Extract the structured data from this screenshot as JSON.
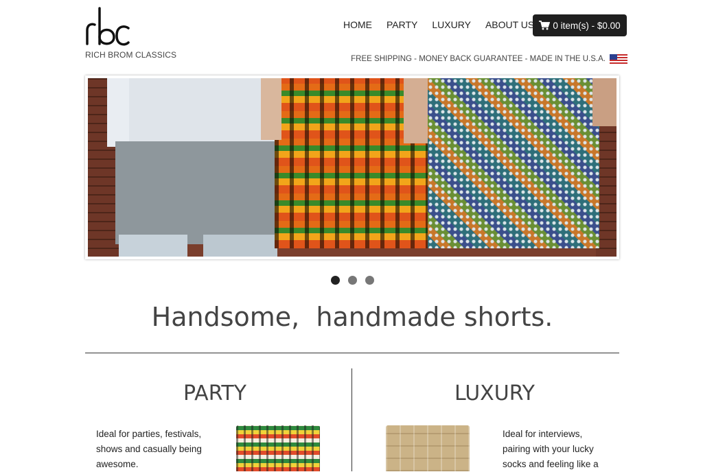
{
  "brand": {
    "logo_text": "rbc",
    "name": "RICH BROM CLASSICS"
  },
  "nav": [
    {
      "label": "HOME"
    },
    {
      "label": "PARTY"
    },
    {
      "label": "LUXURY"
    },
    {
      "label": "ABOUT US"
    }
  ],
  "cart": {
    "label": "0 item(s) - $0.00",
    "icon": "shopping-cart-icon"
  },
  "shipping_banner": {
    "text": "FREE SHIPPING - MONEY BACK GUARANTEE - MADE IN THE U.S.A.",
    "icon": "us-flag-icon"
  },
  "carousel": {
    "slides": 3,
    "active_slide": 1
  },
  "tagline": "Handsome,  handmade shorts.",
  "sections": {
    "party": {
      "title": "PARTY",
      "text": "Ideal for parties, festivals, shows and casually being awesome."
    },
    "luxury": {
      "title": "LUXURY",
      "text": "Ideal for interviews, pairing with your lucky socks and feeling like a"
    }
  },
  "colors": {
    "cart_bg": "#1f1f1f",
    "text": "#333333",
    "dot_active": "#222222",
    "dot_inactive": "#777777"
  }
}
